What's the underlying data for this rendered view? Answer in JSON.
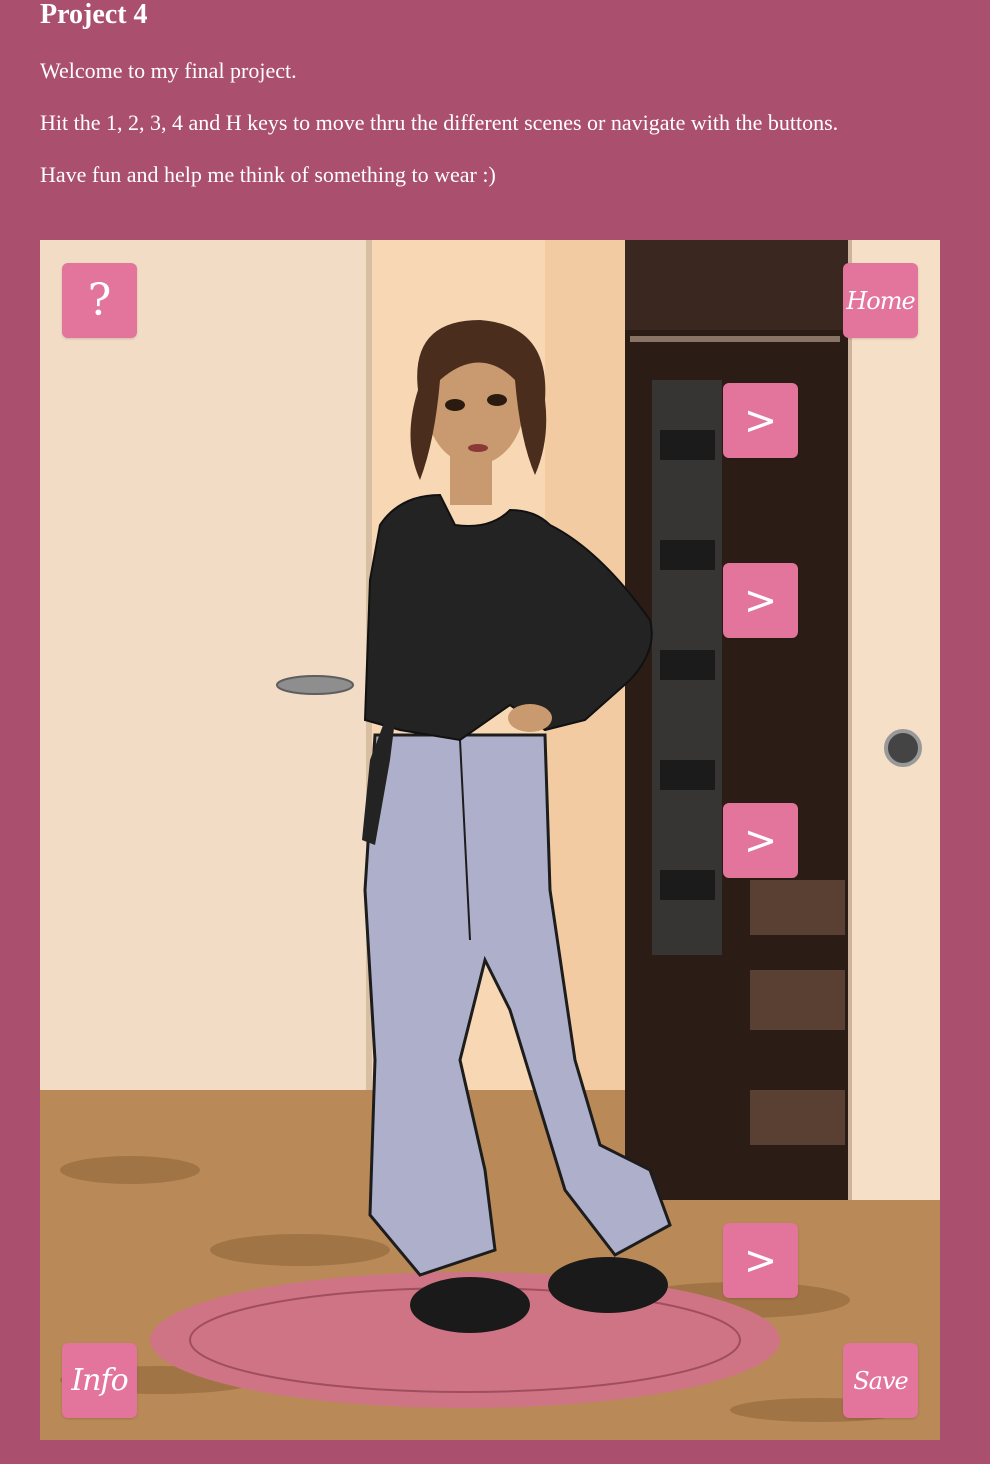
{
  "page": {
    "title": "Project 4",
    "paragraphs": [
      "Welcome to my final project.",
      "Hit the 1, 2, 3, 4 and H keys to move thru the different scenes or navigate with the buttons.",
      "Have fun and help me think of something to wear :)"
    ]
  },
  "scene": {
    "help_label": "?",
    "home_label": "Home",
    "info_label": "Info",
    "save_label": "Save",
    "next_labels": [
      ">",
      ">",
      ">",
      ">"
    ]
  },
  "colors": {
    "page_bg": "#ab4f6e",
    "button_bg": "#e3749b",
    "rug": "#cf7484",
    "top": "#222222",
    "jeans": "#aeb0cb",
    "hair": "#4a2d1d",
    "skin": "#c9996f"
  },
  "icons": [
    "question-icon",
    "next-arrow-icon"
  ]
}
